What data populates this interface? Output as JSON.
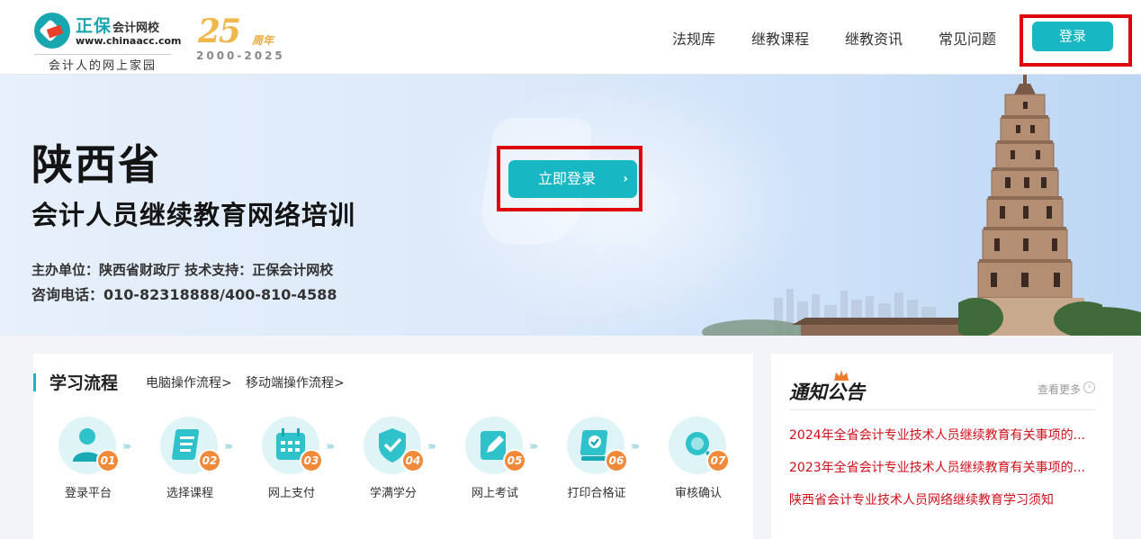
{
  "header": {
    "logo": {
      "brand": "正保",
      "brand_sub": "会计网校",
      "url": "www.chinaacc.com",
      "slogan": "会计人的网上家园"
    },
    "anniversary": {
      "number": "25",
      "suffix": "周年",
      "years": "2000-2025"
    },
    "nav": [
      "法规库",
      "继教课程",
      "继教资讯",
      "常见问题"
    ],
    "login_label": "登录",
    "accent_color": "#17b8c3",
    "highlight_color": "#e0000b"
  },
  "banner": {
    "title": "陕西省",
    "subtitle": "会计人员继续教育网络培训",
    "organizer": "主办单位：陕西省财政厅   技术支持：正保会计网校",
    "phone": "咨询电话：010-82318888/400-810-4588",
    "cta_label": "立即登录",
    "cta_chevron": "›"
  },
  "study": {
    "title": "学习流程",
    "links": [
      "电脑操作流程>",
      "移动端操作流程>"
    ],
    "steps": [
      {
        "num": "01",
        "label": "登录平台",
        "icon": "user-icon"
      },
      {
        "num": "02",
        "label": "选择课程",
        "icon": "document-icon"
      },
      {
        "num": "03",
        "label": "网上支付",
        "icon": "calendar-icon"
      },
      {
        "num": "04",
        "label": "学满学分",
        "icon": "shield-check-icon"
      },
      {
        "num": "05",
        "label": "网上考试",
        "icon": "pencil-icon"
      },
      {
        "num": "06",
        "label": "打印合格证",
        "icon": "certificate-icon"
      },
      {
        "num": "07",
        "label": "审核确认",
        "icon": "search-icon"
      }
    ]
  },
  "notice": {
    "title": "通知公告",
    "more": "查看更多",
    "more_icon": "›",
    "items": [
      "2024年全省会计专业技术人员继续教育有关事项的...",
      "2023年全省会计专业技术人员继续教育有关事项的...",
      "陕西省会计专业技术人员网络继续教育学习须知"
    ]
  }
}
